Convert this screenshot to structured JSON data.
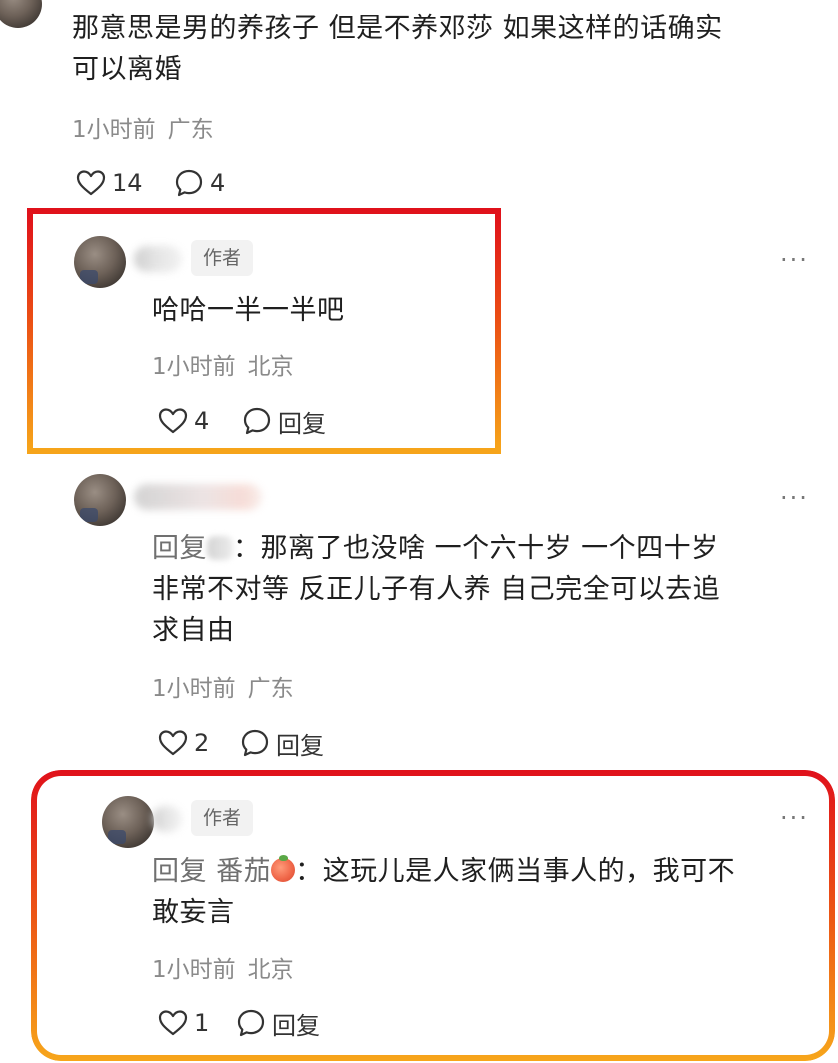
{
  "comments": [
    {
      "text_lines": [
        "那意思是男的养孩子 但是不养邓莎 如果这样的话确实",
        "可以离婚"
      ],
      "time": "1小时前",
      "location": "广东",
      "likes": "14",
      "replies": "4"
    },
    {
      "badge": "作者",
      "text_lines": [
        "哈哈一半一半吧"
      ],
      "time": "1小时前",
      "location": "北京",
      "likes": "4",
      "reply_label": "回复"
    },
    {
      "reply_prefix": "回复",
      "separator": "：",
      "text_line1": "那离了也没啥 一个六十岁 一个四十岁",
      "text_lines_more": [
        "非常不对等 反正儿子有人养 自己完全可以去追",
        "求自由"
      ],
      "time": "1小时前",
      "location": "广东",
      "likes": "2",
      "reply_label": "回复"
    },
    {
      "badge": "作者",
      "reply_prefix": "回复",
      "mention_name": "番茄",
      "separator": "：",
      "text_line1": "这玩儿是人家俩当事人的，我可不",
      "text_lines_more": [
        "敢妄言"
      ],
      "time": "1小时前",
      "location": "北京",
      "likes": "1",
      "reply_label": "回复"
    }
  ],
  "more_glyph": "···",
  "colors": {
    "highlight_top": "#e0111b",
    "highlight_bottom": "#f7a61b"
  },
  "icons": [
    "heart-icon",
    "comment-bubble-icon",
    "more-icon",
    "tomato-emoji-icon"
  ]
}
